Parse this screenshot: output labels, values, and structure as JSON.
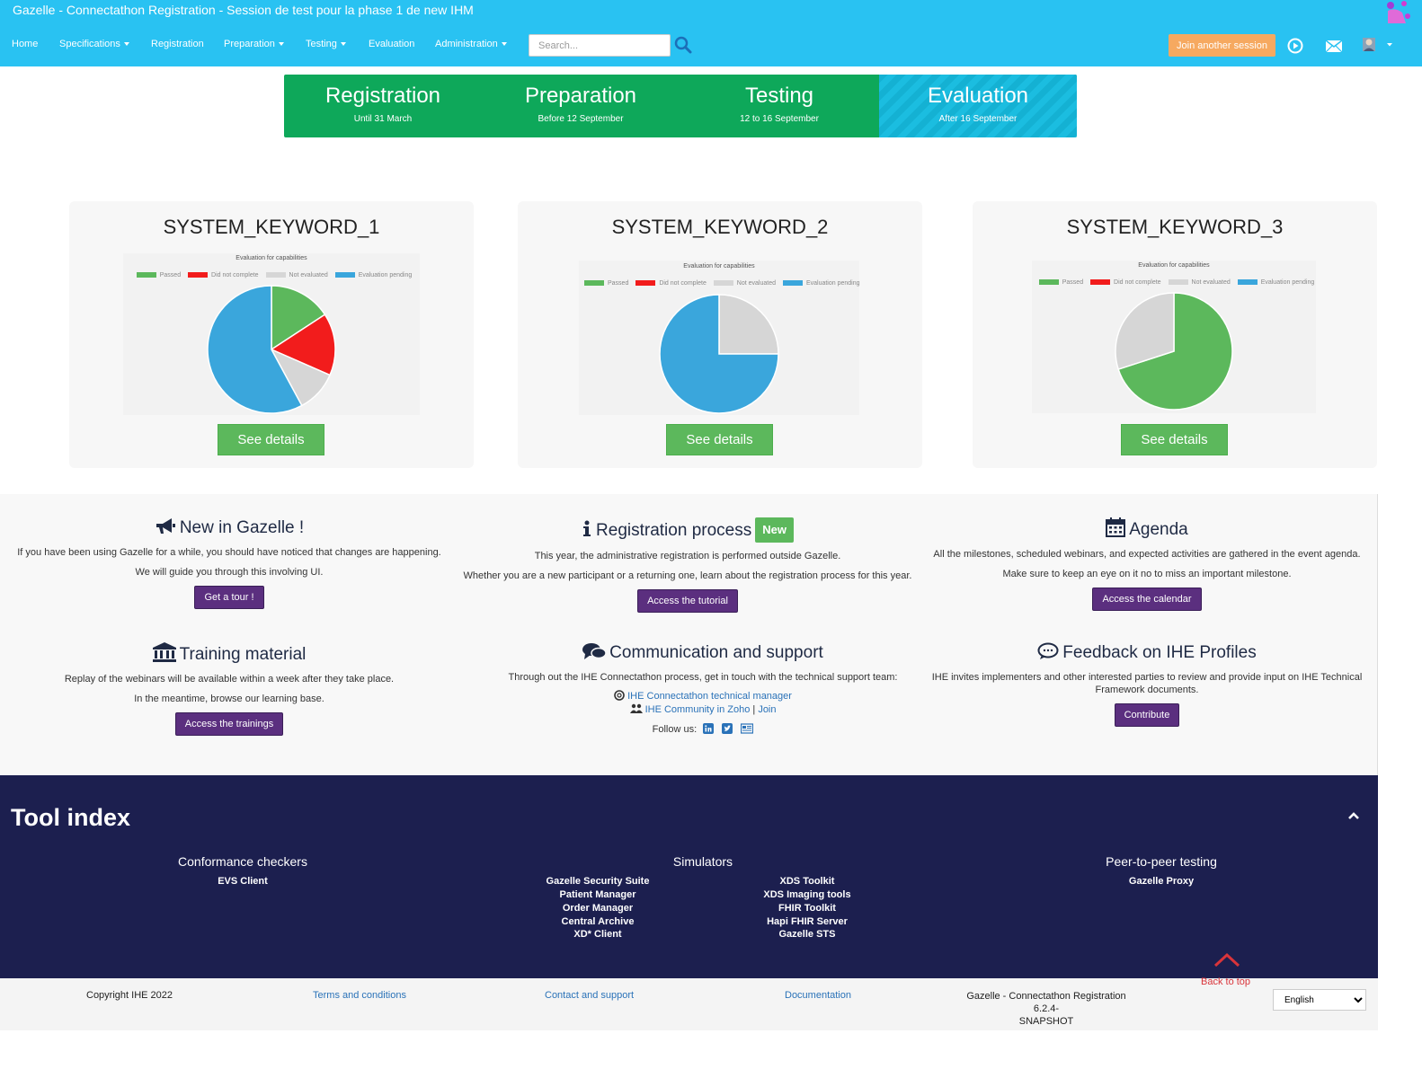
{
  "window": {
    "title": "Gazelle - Connectathon Registration - Session de test pour la phase 1 de new IHM"
  },
  "nav": {
    "items": [
      {
        "label": "Home",
        "dropdown": false
      },
      {
        "label": "Specifications",
        "dropdown": true
      },
      {
        "label": "Registration",
        "dropdown": false
      },
      {
        "label": "Preparation",
        "dropdown": true
      },
      {
        "label": "Testing",
        "dropdown": true
      },
      {
        "label": "Evaluation",
        "dropdown": false
      },
      {
        "label": "Administration",
        "dropdown": true
      }
    ],
    "search_placeholder": "Search...",
    "join_label": "Join another session",
    "icons": [
      "play-circle-icon",
      "envelope-icon",
      "user-avatar-icon"
    ]
  },
  "phases": [
    {
      "name": "Registration",
      "date": "Until 31 March",
      "active": false
    },
    {
      "name": "Preparation",
      "date": "Before 12 September",
      "active": false
    },
    {
      "name": "Testing",
      "date": "12 to 16 September",
      "active": false
    },
    {
      "name": "Evaluation",
      "date": "After 16 September",
      "active": true
    }
  ],
  "systems": [
    {
      "keyword": "SYSTEM_KEYWORD_1",
      "details_label": "See details"
    },
    {
      "keyword": "SYSTEM_KEYWORD_2",
      "details_label": "See details"
    },
    {
      "keyword": "SYSTEM_KEYWORD_3",
      "details_label": "See details"
    }
  ],
  "chart_legend_colors": {
    "Passed": "#5cb85c",
    "Did not complete": "#f21c1c",
    "Not evaluated": "#d6d6d6",
    "Evaluation pending": "#3aa6dc"
  },
  "chart_data": [
    {
      "type": "pie",
      "title": "Evaluation for capabilities",
      "legend": "top",
      "categories": [
        "Passed",
        "Did not complete",
        "Not evaluated",
        "Evaluation pending"
      ],
      "values": [
        1.5,
        1.5,
        1,
        5.5
      ],
      "colors": [
        "#5cb85c",
        "#f21c1c",
        "#d6d6d6",
        "#3aa6dc"
      ]
    },
    {
      "type": "pie",
      "title": "Evaluation for capabilities",
      "legend": "top",
      "categories": [
        "Passed",
        "Did not complete",
        "Not evaluated",
        "Evaluation pending"
      ],
      "values": [
        0,
        0,
        1,
        3
      ],
      "colors": [
        "#5cb85c",
        "#f21c1c",
        "#d6d6d6",
        "#3aa6dc"
      ]
    },
    {
      "type": "pie",
      "title": "Evaluation for capabilities",
      "legend": "top",
      "categories": [
        "Passed",
        "Did not complete",
        "Not evaluated",
        "Evaluation pending"
      ],
      "values": [
        7,
        0,
        3,
        0
      ],
      "colors": [
        "#5cb85c",
        "#f21c1c",
        "#d6d6d6",
        "#3aa6dc"
      ]
    }
  ],
  "info": {
    "new_in_gazelle": {
      "title": "New in Gazelle !",
      "line1": "If you have been using Gazelle for a while, you should have noticed that changes are happening.",
      "line2": "We will guide you through this involving UI.",
      "button": "Get a tour !"
    },
    "registration_process": {
      "title": "Registration process",
      "badge": "New",
      "line1": "This year, the administrative registration is performed outside Gazelle.",
      "line2": "Whether you are a new participant or a returning one, learn about the registration process for this year.",
      "button": "Access the tutorial"
    },
    "agenda": {
      "title": "Agenda",
      "line1": "All the milestones, scheduled webinars, and expected activities are gathered in the event agenda.",
      "line2": "Make sure to keep an eye on it no to miss an important milestone.",
      "button": "Access the calendar"
    },
    "training": {
      "title": "Training material",
      "line1": "Replay of the webinars will be available within a week after they take place.",
      "line2": "In the meantime, browse our learning base.",
      "button": "Access the trainings"
    },
    "communication": {
      "title": "Communication and support",
      "line1": "Through out the IHE Connectathon process, get in touch with the technical support team:",
      "link1": "IHE Connectathon technical manager",
      "link2a": "IHE Community in Zoho",
      "sep": "|",
      "link2b": "Join",
      "follow": "Follow us:"
    },
    "feedback": {
      "title": "Feedback on IHE Profiles",
      "line1": "IHE invites implementers and other interested parties to review and provide input on IHE Technical Framework documents.",
      "button": "Contribute"
    }
  },
  "tools": {
    "title": "Tool index",
    "conformance": {
      "title": "Conformance checkers",
      "items": [
        "EVS Client"
      ]
    },
    "simulators": {
      "title": "Simulators",
      "col1": [
        "Gazelle Security Suite",
        "Patient Manager",
        "Order Manager",
        "Central Archive",
        "XD* Client"
      ],
      "col2": [
        "XDS Toolkit",
        "XDS Imaging tools",
        "FHIR Toolkit",
        "Hapi FHIR Server",
        "Gazelle STS"
      ]
    },
    "p2p": {
      "title": "Peer-to-peer testing",
      "items": [
        "Gazelle Proxy"
      ]
    },
    "back_to_top": "Back to top"
  },
  "footer": {
    "copyright": "Copyright IHE 2022",
    "terms": "Terms and conditions",
    "contact": "Contact and support",
    "docs": "Documentation",
    "version_line1": "Gazelle - Connectathon Registration 6.2.4-",
    "version_line2": "SNAPSHOT",
    "language": "English"
  }
}
